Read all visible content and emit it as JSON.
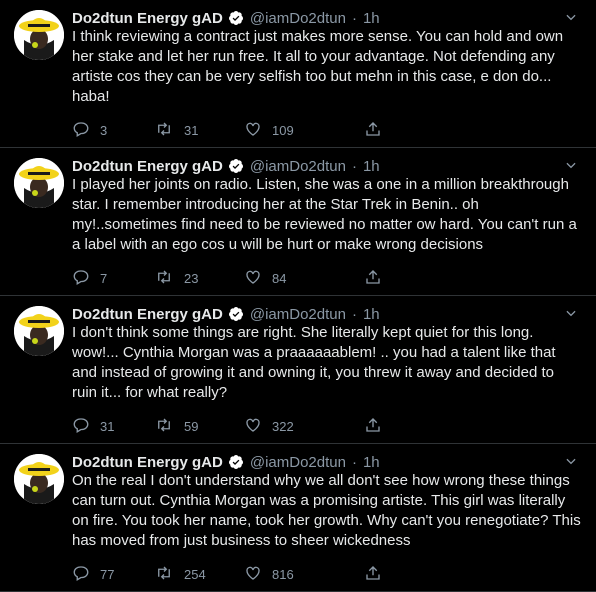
{
  "tweets": [
    {
      "name": "Do2dtun Energy gAD",
      "handle": "@iamDo2dtun",
      "dot": "·",
      "time": "1h",
      "text": "I think reviewing a contract just makes more sense. You can hold and own her stake and let her run free. It all to your advantage. Not defending any artiste cos they can be very selfish too but mehn in this case, e don do... haba!",
      "replies": "3",
      "retweets": "31",
      "likes": "109"
    },
    {
      "name": "Do2dtun Energy gAD",
      "handle": "@iamDo2dtun",
      "dot": "·",
      "time": "1h",
      "text": "I played her joints on radio. Listen, she was a one in a million breakthrough star. I remember introducing her at the Star Trek in Benin.. oh my!..sometimes find need to be reviewed no matter ow hard. You can't run a a label with an ego cos u will be hurt or make wrong decisions",
      "replies": "7",
      "retweets": "23",
      "likes": "84"
    },
    {
      "name": "Do2dtun Energy gAD",
      "handle": "@iamDo2dtun",
      "dot": "·",
      "time": "1h",
      "text": "I don't think some things are right. She literally kept quiet for this long. wow!... Cynthia Morgan was a praaaaaablem! .. you had a talent like that and instead of growing it and owning it, you threw it away and decided to ruin it... for what really?",
      "replies": "31",
      "retweets": "59",
      "likes": "322"
    },
    {
      "name": "Do2dtun Energy gAD",
      "handle": "@iamDo2dtun",
      "dot": "·",
      "time": "1h",
      "text": "On the real I don't understand why we all don't see how wrong these things can turn out. Cynthia Morgan was a promising artiste. This girl was literally on fire. You took her name, took her growth. Why can't you renegotiate? This has moved from just business to sheer wickedness",
      "replies": "77",
      "retweets": "254",
      "likes": "816"
    }
  ],
  "colors": {
    "background": "#000000",
    "text": "#e7e9ea",
    "muted": "#8b98a5",
    "divider": "#2f3336",
    "verified": "#ffffff"
  },
  "icons": [
    "verified-badge-icon",
    "chevron-down-icon",
    "reply-icon",
    "retweet-icon",
    "like-icon",
    "share-icon"
  ]
}
